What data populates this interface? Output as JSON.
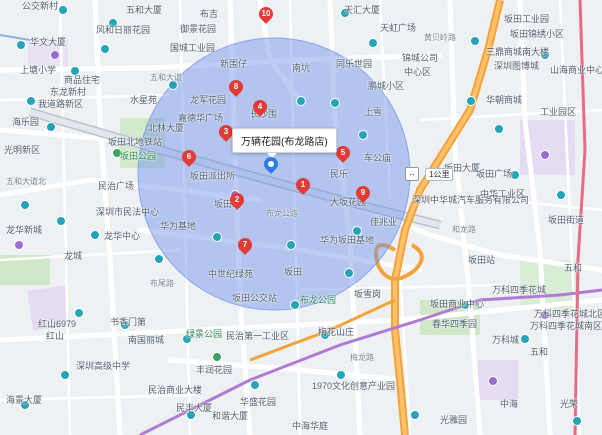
{
  "map": {
    "center_label": "万辆花园(布龙路店)",
    "radius_label": "1公里",
    "radius_handle_icon": "arrows-left-right-icon",
    "colors": {
      "circle_fill": "#6b8fe8",
      "marker": "#e23b36",
      "center_marker": "#2e7de0",
      "highway": "#f4a23a",
      "metro": "#b07bd4",
      "road": "#ffffff",
      "green": "#cfe8c8",
      "purple_area": "#e5dcf2"
    },
    "markers": [
      {
        "num": "1"
      },
      {
        "num": "2"
      },
      {
        "num": "3"
      },
      {
        "num": "4"
      },
      {
        "num": "5"
      },
      {
        "num": "6"
      },
      {
        "num": "7"
      },
      {
        "num": "8"
      },
      {
        "num": "9"
      },
      {
        "num": "10"
      }
    ],
    "labels": {
      "l1": "公交新村",
      "l2": "风和日丽花园",
      "l3": "五和大厦",
      "l4": "御景花园",
      "l5": "华文大厦",
      "l6": "国城工业园",
      "l7": "天汇大厦",
      "l8": "天虹广场",
      "l9": "黄贝岭路",
      "l10": "东龙新村",
      "l11": "我道路新区",
      "l12": "坂田工业园",
      "l13": "坂田锦绣小区",
      "l14": "三鼎商城南大楼",
      "l15": "深圳图博城",
      "l16": "锦城公司",
      "l17": "中心区",
      "l18": "山海商业中心",
      "l19": "工业园区",
      "l20": "华朝商城",
      "l21": "上塘小学",
      "l22": "商品住宅",
      "l23": "水星苑",
      "l24": "龙军花园",
      "l25": "嘉德华广场",
      "l26": "北林大厦",
      "l27": "同乐世园",
      "l28": "鹏城小区",
      "l29": "坂田公园",
      "l30": "五和大道",
      "l31": "海乐园",
      "l32": "深圳市民法中心",
      "l33": "龙华中心",
      "l34": "民治广场",
      "l35": "坂田北",
      "l36": "布龙公路",
      "l37": "和龙路",
      "l38": "车公庙",
      "l39": "大坂花园",
      "l40": "深圳中华城汽车服务有限公司",
      "l41": "坂田站",
      "l42": "万科四季花城",
      "l43": "坂田广场",
      "l44": "坂田大厦",
      "l45": "中华工业区",
      "l46": "万科四季花城北区",
      "l47": "万科四季花城南区",
      "l48": "春华四季园",
      "l49": "坂田商业中心",
      "l50": "民治第一工业区",
      "l51": "梅花山庄",
      "l52": "深圳高级中学",
      "l53": "民治商业大楼",
      "l54": "南国丽城",
      "l55": "书香门第",
      "l56": "绿景公园",
      "l57": "梅龙路",
      "l58": "红山6979",
      "l59": "红山",
      "l60": "海景大厦",
      "l61": "丰润花园",
      "l62": "华盛花园",
      "l63": "1970文化创意产业园",
      "l64": "五和",
      "l65": "光雅园",
      "l66": "布龙公园",
      "l67": "和谐大厦",
      "l68": "民丰大厦",
      "l69": "中海华庭",
      "l70": "布尾路",
      "l71": "坂雪岗",
      "l72": "坂田",
      "l73": "中世纪绿苑",
      "l74": "坂田公交站",
      "l75": "华为基地",
      "l76": "五和大道北",
      "l77": "华为坂田基地",
      "l78": "龙华新城",
      "l79": "民乐",
      "l80": "坂田派出所",
      "l81": "龙城",
      "l82": "万科城",
      "l83": "光明新区",
      "l84": "新围仔",
      "l85": "南坑",
      "l86": "长沙围",
      "l87": "五和",
      "l88": "坂田街道",
      "l89": "中海",
      "l90": "光荣",
      "l91": "坂田北地铁站",
      "l92": "上雪",
      "l93": "佳兆业",
      "l94": "布吉"
    }
  }
}
